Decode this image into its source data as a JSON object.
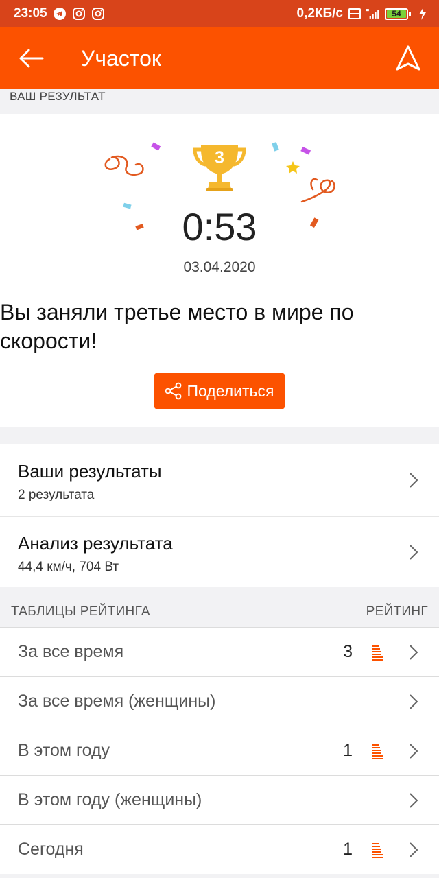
{
  "status_bar": {
    "time": "23:05",
    "speed": "0,2КБ/с",
    "battery": "54"
  },
  "toolbar": {
    "title": "Участок"
  },
  "result": {
    "section_label": "ВАШ РЕЗУЛЬТАТ",
    "trophy_rank": "3",
    "time": "0:53",
    "date": "03.04.2020",
    "message": "Вы заняли третье место в мире по скорости!",
    "share_label": "Поделиться"
  },
  "links": [
    {
      "title": "Ваши результаты",
      "subtitle": "2 результата"
    },
    {
      "title": "Анализ результата",
      "subtitle": "44,4 км/ч, 704 Вт"
    }
  ],
  "leaderboards": {
    "header_left": "ТАБЛИЦЫ РЕЙТИНГА",
    "header_right": "РЕЙТИНГ",
    "rows": [
      {
        "label": "За все время",
        "rank": "3"
      },
      {
        "label": "За все время (женщины)",
        "rank": ""
      },
      {
        "label": "В этом году",
        "rank": "1"
      },
      {
        "label": "В этом году (женщины)",
        "rank": ""
      },
      {
        "label": "Сегодня",
        "rank": "1"
      }
    ]
  },
  "colors": {
    "brand": "#fc5200",
    "status_bar": "#d8441a",
    "trophy": "#f5b82e"
  },
  "icons": {
    "back": "arrow-left-icon",
    "navigate": "navigation-arrow-icon",
    "share": "share-icon",
    "chevron": "chevron-right-icon",
    "leaderboard": "leaderboard-icon"
  }
}
